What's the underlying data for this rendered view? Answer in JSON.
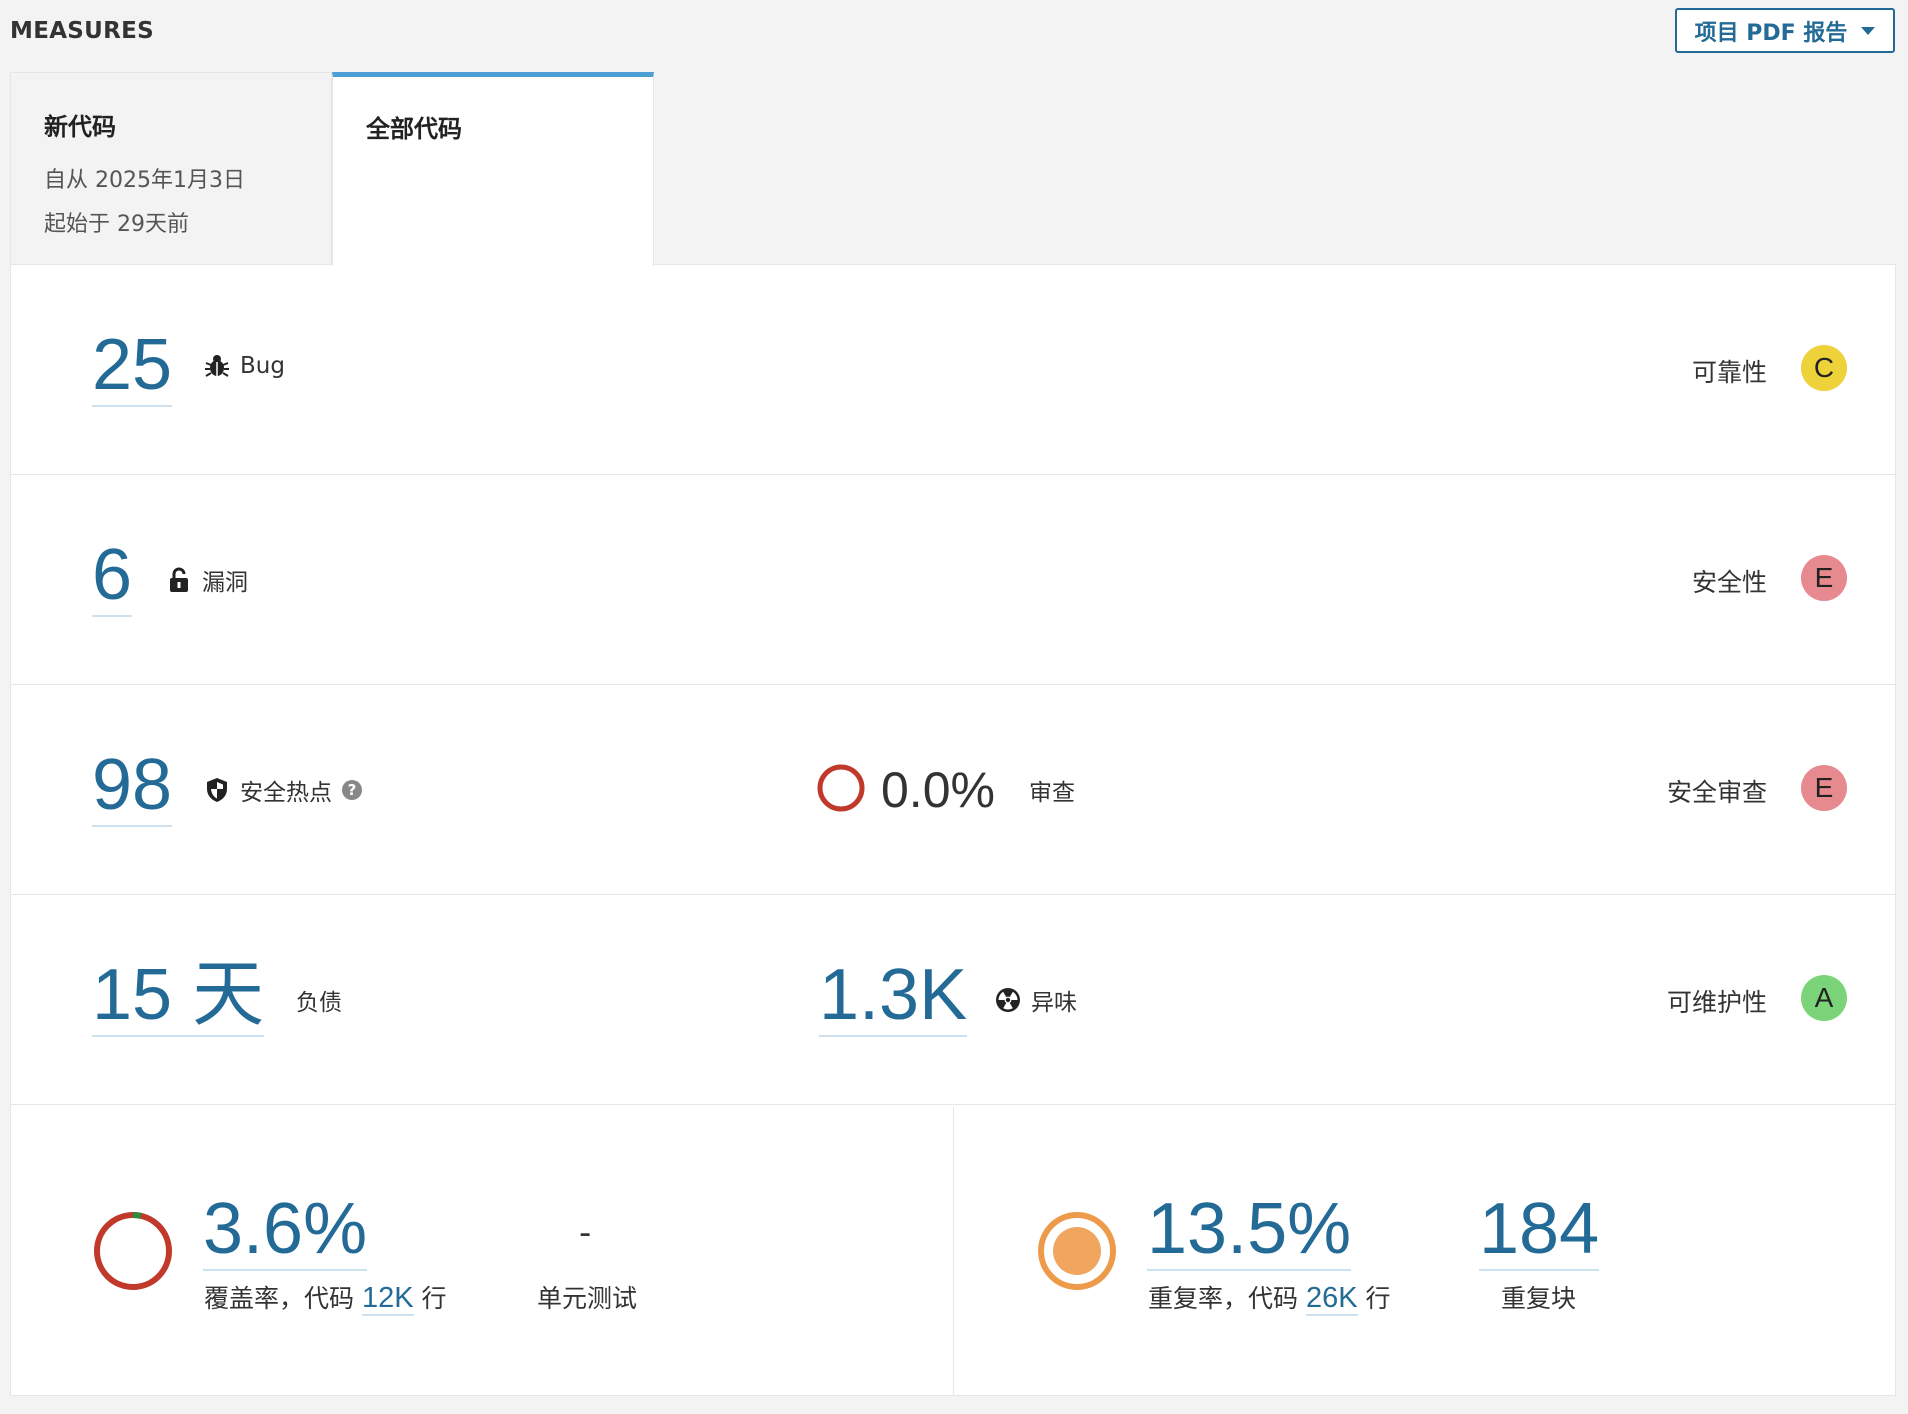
{
  "header": {
    "title": "MEASURES",
    "pdf_button": "项目 PDF 报告"
  },
  "tabs": [
    {
      "title": "新代码",
      "line1": "自从 2025年1月3日",
      "line2": "起始于 29天前"
    },
    {
      "title": "全部代码"
    }
  ],
  "active_tab": "全部代码",
  "reliability": {
    "bugs": "25",
    "bugs_label": "Bug",
    "rating_label": "可靠性",
    "rating": "C",
    "rating_color": "#eed23a"
  },
  "security": {
    "vulns": "6",
    "vulns_label": "漏洞",
    "rating_label": "安全性",
    "rating": "E",
    "rating_color": "#e68a8f"
  },
  "hotspots": {
    "count": "98",
    "label": "安全热点",
    "help": "?",
    "reviewed": "0.0%",
    "reviewed_label": "审查",
    "rating_label": "安全审查",
    "rating": "E",
    "rating_color": "#e68a8f"
  },
  "maintainability": {
    "debt": "15 天",
    "debt_label": "负债",
    "smells": "1.3K",
    "smells_label": "异味",
    "rating_label": "可维护性",
    "rating": "A",
    "rating_color": "#7cd47a"
  },
  "coverage": {
    "value": "3.6%",
    "label_prefix": "覆盖率，代码",
    "lines": "12K",
    "label_suffix": "行",
    "unit_tests": "-",
    "unit_tests_label": "单元测试",
    "coverage_fraction": 0.036
  },
  "duplication": {
    "value": "13.5%",
    "label_prefix": "重复率，代码",
    "lines": "26K",
    "label_suffix": "行",
    "blocks": "184",
    "blocks_label": "重复块"
  },
  "colors": {
    "accent": "#236a97",
    "tab_active": "#4b9fd5",
    "coverage_ring": "#c0392b",
    "coverage_good": "#2e8b3e",
    "dup_ring": "#ed9b4a",
    "dup_fill": "#f0a65e"
  }
}
